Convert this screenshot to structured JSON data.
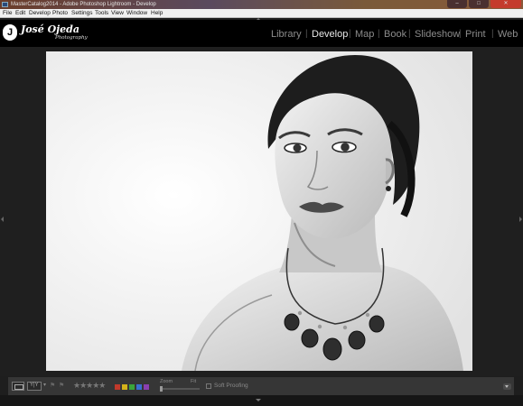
{
  "window": {
    "title": "MasterCatalog2014 - Adobe Photoshop Lightroom - Develop",
    "controls": {
      "minimize": "–",
      "maximize": "□",
      "close": "✕"
    }
  },
  "menu": {
    "items": [
      {
        "label": "File"
      },
      {
        "label": "Edit"
      },
      {
        "label": "Develop"
      },
      {
        "label": "Photo"
      },
      {
        "label": "Settings"
      },
      {
        "label": "Tools"
      },
      {
        "label": "View"
      },
      {
        "label": "Window"
      },
      {
        "label": "Help"
      }
    ]
  },
  "identity_plate": {
    "mark": "J",
    "name": "José Ojeda",
    "sub": "Photography"
  },
  "modules": {
    "items": [
      {
        "label": "Library"
      },
      {
        "label": "Develop"
      },
      {
        "label": "Map"
      },
      {
        "label": "Book"
      },
      {
        "label": "Slideshow"
      },
      {
        "label": "Print"
      },
      {
        "label": "Web"
      }
    ],
    "active": "Develop"
  },
  "toolbar": {
    "compare_label": "Y|Y",
    "rating": "★★★★★",
    "zoom_label": "Zoom",
    "zoom_value": "Fit",
    "soft_proofing": "Soft Proofing",
    "color_labels": [
      "#c0392b",
      "#d4b21a",
      "#3aa53a",
      "#3a6fd0",
      "#8a3fb0"
    ]
  },
  "icons": {
    "loupe_view": "loupe-view-icon",
    "compare_view": "compare-view-icon",
    "flag": "flag-icon",
    "menu_arrow": "chevron-down-icon"
  }
}
